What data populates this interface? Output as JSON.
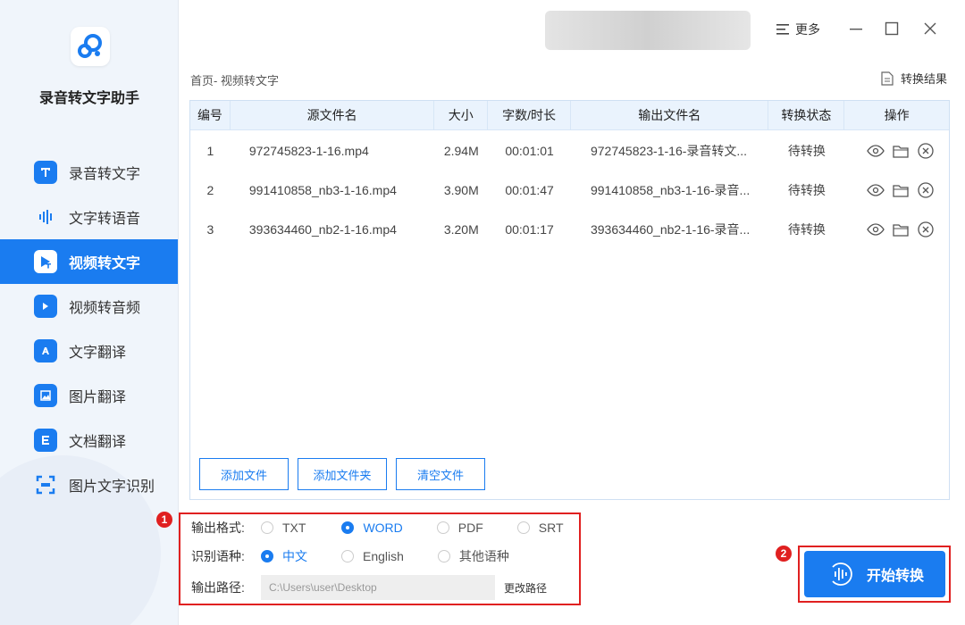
{
  "app": {
    "name": "录音转文字助手"
  },
  "sidebar": {
    "items": [
      {
        "label": "录音转文字",
        "icon": "text-t-icon",
        "active": false
      },
      {
        "label": "文字转语音",
        "icon": "audio-wave-icon",
        "active": false
      },
      {
        "label": "视频转文字",
        "icon": "video-text-icon",
        "active": true
      },
      {
        "label": "视频转音频",
        "icon": "video-audio-icon",
        "active": false
      },
      {
        "label": "文字翻译",
        "icon": "text-translate-icon",
        "active": false
      },
      {
        "label": "图片翻译",
        "icon": "image-translate-icon",
        "active": false
      },
      {
        "label": "文档翻译",
        "icon": "doc-translate-icon",
        "active": false
      },
      {
        "label": "图片文字识别",
        "icon": "ocr-scan-icon",
        "active": false
      }
    ]
  },
  "titlebar": {
    "more_label": "更多"
  },
  "breadcrumb": "首页- 视频转文字",
  "result_label": "转换结果",
  "table": {
    "columns": [
      "编号",
      "源文件名",
      "大小",
      "字数/时长",
      "输出文件名",
      "转换状态",
      "操作"
    ],
    "rows": [
      {
        "no": "1",
        "source": "972745823-1-16.mp4",
        "size": "2.94M",
        "duration": "00:01:01",
        "output": "972745823-1-16-录音转文...",
        "status": "待转换"
      },
      {
        "no": "2",
        "source": "991410858_nb3-1-16.mp4",
        "size": "3.90M",
        "duration": "00:01:47",
        "output": "991410858_nb3-1-16-录音...",
        "status": "待转换"
      },
      {
        "no": "3",
        "source": "393634460_nb2-1-16.mp4",
        "size": "3.20M",
        "duration": "00:01:17",
        "output": "393634460_nb2-1-16-录音...",
        "status": "待转换"
      }
    ]
  },
  "buttons": {
    "add_file": "添加文件",
    "add_folder": "添加文件夹",
    "clear_files": "清空文件"
  },
  "options": {
    "format_label": "输出格式:",
    "formats": [
      "TXT",
      "WORD",
      "PDF",
      "SRT"
    ],
    "format_selected": "WORD",
    "language_label": "识别语种:",
    "languages": [
      "中文",
      "English",
      "其他语种"
    ],
    "language_selected": "中文",
    "path_label": "输出路径:",
    "path_value": "C:\\Users\\user\\Desktop",
    "change_path": "更改路径"
  },
  "badges": {
    "first": "1",
    "second": "2"
  },
  "start_label": "开始转换",
  "colors": {
    "accent": "#1a7cf0",
    "highlight": "#e02020"
  }
}
